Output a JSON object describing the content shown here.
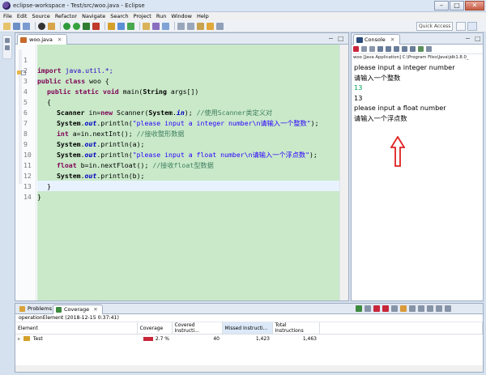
{
  "window": {
    "title": "eclipse-workspace - Test/src/woo.java - Eclipse",
    "minimize": "–",
    "maximize": "□",
    "close": "✕"
  },
  "menu": [
    "File",
    "Edit",
    "Source",
    "Refactor",
    "Navigate",
    "Search",
    "Project",
    "Run",
    "Window",
    "Help"
  ],
  "toolbar": {
    "quick_access_placeholder": "Quick Access"
  },
  "editor": {
    "tab_label": "woo.java",
    "tab_close": "✕",
    "minimize": "−",
    "maximize": "□",
    "lines": [
      {
        "n": "1"
      },
      {
        "n": "2"
      },
      {
        "n": "3"
      },
      {
        "n": "4"
      },
      {
        "n": "5"
      },
      {
        "n": "6"
      },
      {
        "n": "7"
      },
      {
        "n": "8"
      },
      {
        "n": "9"
      },
      {
        "n": "10"
      },
      {
        "n": "11"
      },
      {
        "n": "12"
      },
      {
        "n": "13"
      },
      {
        "n": "14"
      }
    ],
    "code": {
      "l1_kw": "import",
      "l1_rest": " java.util.*;",
      "l2_kw": "public class",
      "l2_rest": " woo {",
      "l3_kw": "public static void",
      "l3_mth": " main(",
      "l3_cls": "String",
      "l3_rest": " args[])",
      "l4": "{",
      "l5_cls": "Scanner",
      "l5_a": " in=",
      "l5_kw": "new",
      "l5_b": " Scanner(",
      "l5_cls2": "System",
      "l5_dot": ".",
      "l5_fld": "in",
      "l5_c": "); ",
      "l5_cmt": "//使用Scanner类定义对",
      "l6_cls": "System",
      "l6_dot": ".",
      "l6_fld": "out",
      "l6_a": ".println(",
      "l6_str": "\"please input a integer number\\n请输入一个整数\"",
      "l6_b": ");",
      "l7_kw": "int",
      "l7_a": " a=in.nextInt(); ",
      "l7_cmt": "//接收整形数据",
      "l8_cls": "System",
      "l8_dot": ".",
      "l8_fld": "out",
      "l8_a": ".println(a);",
      "l9_cls": "System",
      "l9_dot": ".",
      "l9_fld": "out",
      "l9_a": ".println(",
      "l9_str": "\"please input a float number\\n请输入一个浮点数\"",
      "l9_b": ");",
      "l10_kw": "float",
      "l10_a": " b=in.nextFloat(); ",
      "l10_cmt": "//接收float型数据",
      "l11_cls": "System",
      "l11_dot": ".",
      "l11_fld": "out",
      "l11_a": ".println(b);",
      "l12": "}",
      "l13": "}",
      "l14": ""
    }
  },
  "console": {
    "tab_label": "Console",
    "tab_close": "✕",
    "description": "woo [Java Application] C:\\Program Files\\Java\\jdk1.8.0_",
    "output": [
      {
        "text": "please input a integer number",
        "kind": "out"
      },
      {
        "text": "请输入一个整数",
        "kind": "out"
      },
      {
        "text": "13",
        "kind": "in"
      },
      {
        "text": "13",
        "kind": "out"
      },
      {
        "text": "please input a float number",
        "kind": "out"
      },
      {
        "text": "请输入一个浮点数",
        "kind": "out"
      }
    ],
    "annotation_color": "#e02020"
  },
  "bottom": {
    "tabs": [
      {
        "label": "Problems"
      },
      {
        "label": "Coverage",
        "close": "✕"
      }
    ],
    "operation": "operationElement (2018-12-15 0:37:41)",
    "columns": [
      "Element",
      "Coverage",
      "Covered Instructi...",
      "Missed Instructi...",
      "Total Instructions"
    ],
    "rows": [
      {
        "toggle": "▹",
        "element": "Test",
        "coverage": "2.7 %",
        "covered": "40",
        "missed": "1,423",
        "total": "1,463"
      }
    ]
  },
  "colors": {
    "code_background": "#c9e9c9",
    "keyword": "#7f0055",
    "string": "#2a00ff",
    "comment": "#3f7f5f",
    "input": "#00a05a",
    "coverage_bar": "#c8263a"
  }
}
